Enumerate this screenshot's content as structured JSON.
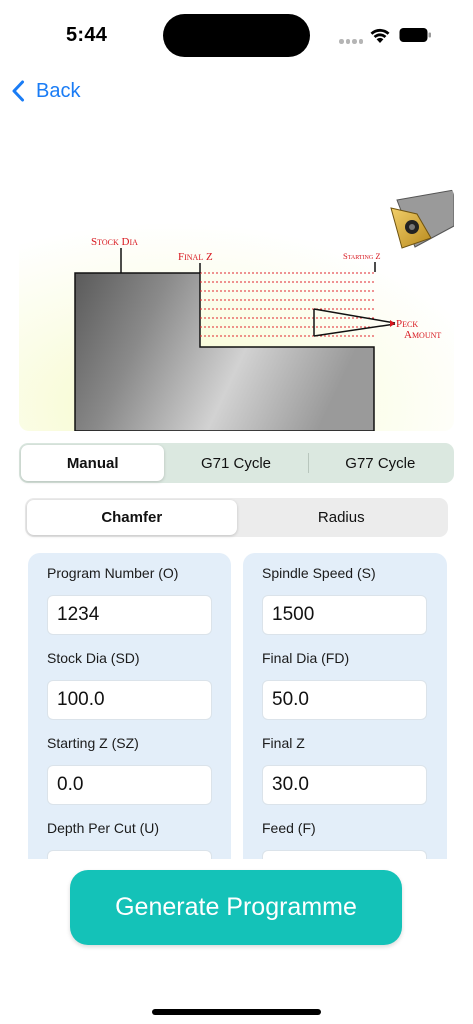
{
  "status_bar": {
    "time": "5:44"
  },
  "nav": {
    "back_label": "Back"
  },
  "diagram": {
    "labels": {
      "stock_dia": "Stock Dia",
      "final_z": "Final Z",
      "starting_z": "Starting Z",
      "peck": "Peck",
      "amount": "Amount"
    }
  },
  "cycle_tabs": {
    "items": [
      "Manual",
      "G71 Cycle",
      "G77 Cycle"
    ],
    "selected": "Manual"
  },
  "shape_tabs": {
    "items": [
      "Chamfer",
      "Radius"
    ],
    "selected": "Chamfer"
  },
  "form": {
    "left": [
      {
        "label": "Program Number (O)",
        "value": "1234"
      },
      {
        "label": "Stock Dia (SD)",
        "value": "100.0"
      },
      {
        "label": "Starting Z (SZ)",
        "value": "0.0"
      },
      {
        "label": "Depth Per Cut (U)",
        "value": ""
      }
    ],
    "right": [
      {
        "label": "Spindle Speed (S)",
        "value": "1500"
      },
      {
        "label": "Final Dia (FD)",
        "value": "50.0"
      },
      {
        "label": "Final Z",
        "value": "30.0"
      },
      {
        "label": "Feed (F)",
        "value": ""
      }
    ]
  },
  "actions": {
    "generate_label": "Generate Programme"
  },
  "colors": {
    "accent_blue": "#1a7cf5",
    "button_teal": "#14c2b8",
    "diagram_red": "#d8171f",
    "form_bg": "#e3eef9"
  }
}
